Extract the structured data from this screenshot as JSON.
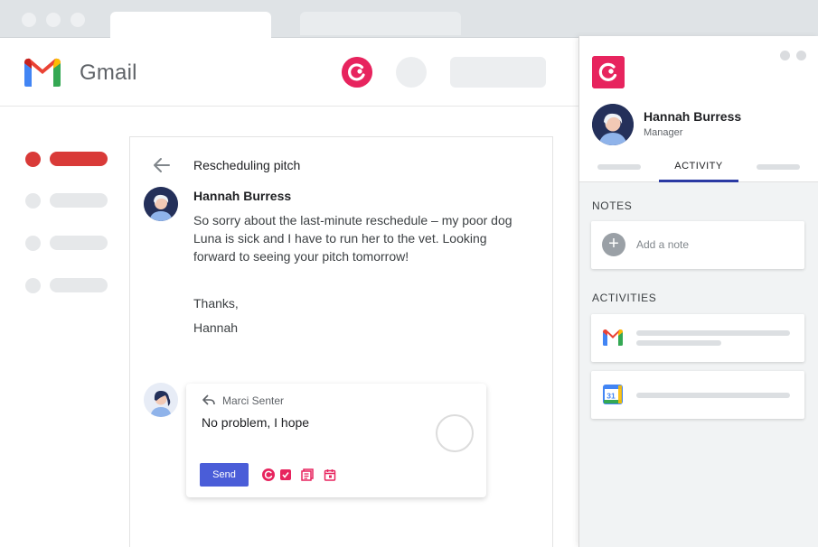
{
  "gmail": {
    "app_name": "Gmail"
  },
  "email": {
    "subject": "Rescheduling pitch",
    "sender": "Hannah Burress",
    "body": "So sorry about the last-minute reschedule – my poor dog Luna is sick and I have to run her to the vet. Looking forward to seeing your pitch tomorrow!",
    "sign_off": "Thanks,",
    "signature": "Hannah"
  },
  "reply": {
    "to": "Marci Senter",
    "text": "No problem, I hope",
    "send_label": "Send"
  },
  "panel": {
    "contact_name": "Hannah Burress",
    "contact_role": "Manager",
    "active_tab": "ACTIVITY",
    "notes_heading": "NOTES",
    "add_note_placeholder": "Add a note",
    "activities_heading": "ACTIVITIES",
    "calendar_day": "31"
  },
  "colors": {
    "copper_brand": "#e7245e",
    "send_button": "#4a5dd8",
    "active_nav": "#d93a38",
    "tab_underline": "#2b3aa3"
  },
  "icons": [
    "copper-logo-icon",
    "back-arrow-icon",
    "reply-arrow-icon",
    "gmail-icon",
    "calendar-icon",
    "task-icon",
    "template-icon",
    "meeting-icon"
  ]
}
